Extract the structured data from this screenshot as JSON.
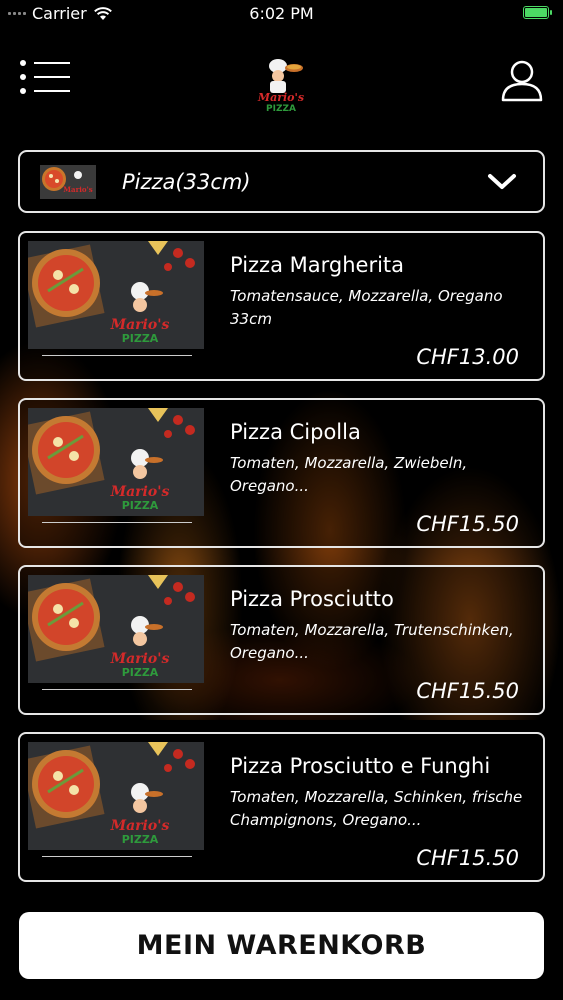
{
  "status_bar": {
    "carrier": "Carrier",
    "time": "6:02 PM"
  },
  "header": {
    "logo_text_top": "Mario's",
    "logo_text_bottom": "PIZZA"
  },
  "category": {
    "selected": "Pizza(33cm)"
  },
  "products": [
    {
      "name": "Pizza Margherita",
      "description": "Tomatensauce, Mozzarella, Oregano 33cm",
      "price": "CHF13.00"
    },
    {
      "name": "Pizza Cipolla",
      "description": "Tomaten, Mozzarella, Zwiebeln, Oregano...",
      "price": "CHF15.50"
    },
    {
      "name": "Pizza Prosciutto",
      "description": "Tomaten, Mozzarella, Trutenschinken, Oregano...",
      "price": "CHF15.50"
    },
    {
      "name": "Pizza Prosciutto e Funghi",
      "description": "Tomaten, Mozzarella, Schinken, frische Champignons, Oregano...",
      "price": "CHF15.50"
    }
  ],
  "cart_button": {
    "label": "MEIN WARENKORB"
  },
  "colors": {
    "background": "#000000",
    "battery": "#4cd964",
    "logo_red": "#d42a2a",
    "logo_green": "#2e9a3c"
  }
}
